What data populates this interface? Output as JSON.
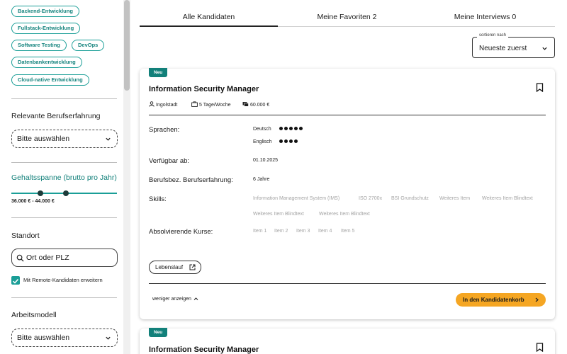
{
  "sidebar": {
    "chips": [
      "Backend-Entwicklung",
      "Fullstack-Entwicklung",
      "Software Testing",
      "DevOps",
      "Datenbankentwicklung",
      "Cloud-native Entwicklung"
    ],
    "experience": {
      "label": "Relevante Berufserfahrung",
      "value": "Bitte auswählen"
    },
    "salary": {
      "label": "Gehaltsspanne (brutto pro Jahr)",
      "range": "36.000 € - 44.000 €"
    },
    "location": {
      "label": "Standort",
      "placeholder": "Ort oder PLZ",
      "remote_label": "Mit Remote-Kandidaten erweitern",
      "remote_checked": true
    },
    "work_model": {
      "label": "Arbeitsmodell",
      "value": "Bitte auswählen"
    }
  },
  "tabs": [
    {
      "label": "Alle Kandidaten",
      "active": true
    },
    {
      "label": "Meine Favoriten 2",
      "active": false
    },
    {
      "label": "Meine Interviews 0",
      "active": false
    }
  ],
  "sort": {
    "legend": "sortieren nach",
    "value": "Neueste zuerst"
  },
  "card": {
    "badge": "Neu",
    "title": "Information Security Manager",
    "meta": {
      "location": "Ingolstadt",
      "workload": "5 Tage/Woche",
      "salary": "60.000 €"
    },
    "languages_label": "Sprachen:",
    "languages": [
      {
        "name": "Deutsch",
        "level": 5
      },
      {
        "name": "Englisch",
        "level": 4
      }
    ],
    "available_label": "Verfügbar ab:",
    "available_value": "01.10.2025",
    "experience_label": "Berufsbez. Berufserfahrung:",
    "experience_value": "6 Jahre",
    "skills_label": "Skills:",
    "skills": [
      "Information Management System (IMS)",
      "ISO 2700x",
      "BSI Grundschutz",
      "Weiteres Item",
      "Weiteres Item Blindtext",
      "Weiteres Item Blindtext",
      "Weiteres Item Blindtext"
    ],
    "courses_label": "Absolvierende Kurse:",
    "courses": [
      "Item 1",
      "Item 2",
      "Item 3",
      "Item 4",
      "Item 5"
    ],
    "cv_label": "Lebenslauf",
    "less_label": "weniger anzeigen",
    "cart_label": "In den Kandidatenkorb"
  },
  "card2": {
    "badge": "Neu",
    "title": "Information Security Manager"
  },
  "colors": {
    "accent": "#1a9e97",
    "cta": "#f5a623"
  }
}
